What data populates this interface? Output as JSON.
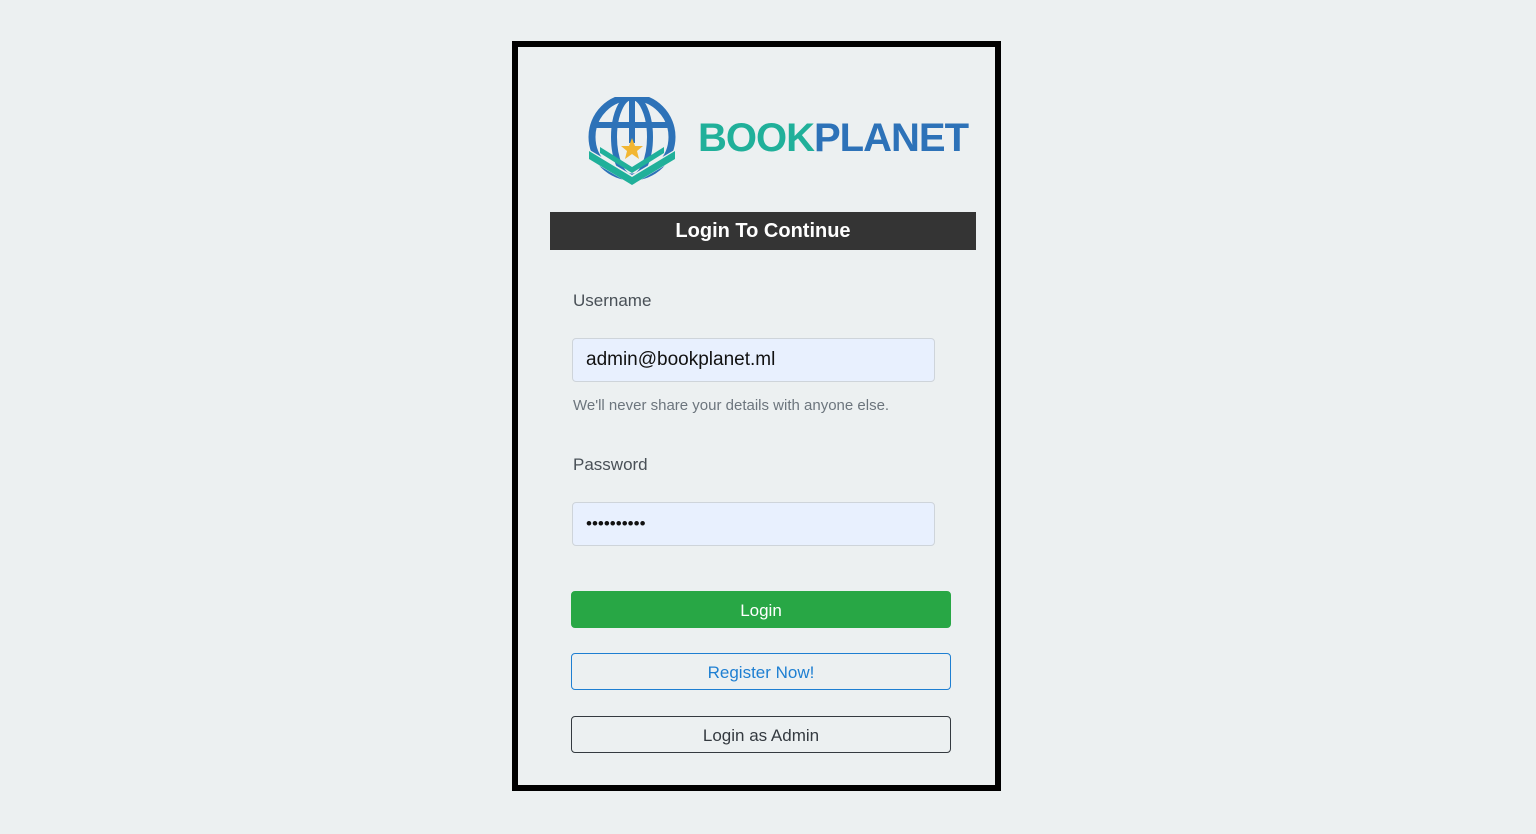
{
  "brand": {
    "part1": "BOOK",
    "part2": "PLANET",
    "color_teal": "#20b09a",
    "color_blue": "#2d72b8",
    "star_color": "#f2b632"
  },
  "header": {
    "title": "Login To Continue"
  },
  "form": {
    "username_label": "Username",
    "username_value": "admin@bookplanet.ml",
    "username_help": "We'll never share your details with anyone else.",
    "password_label": "Password",
    "password_value": "••••••••••"
  },
  "buttons": {
    "login": "Login",
    "register": "Register Now!",
    "admin": "Login as Admin"
  }
}
